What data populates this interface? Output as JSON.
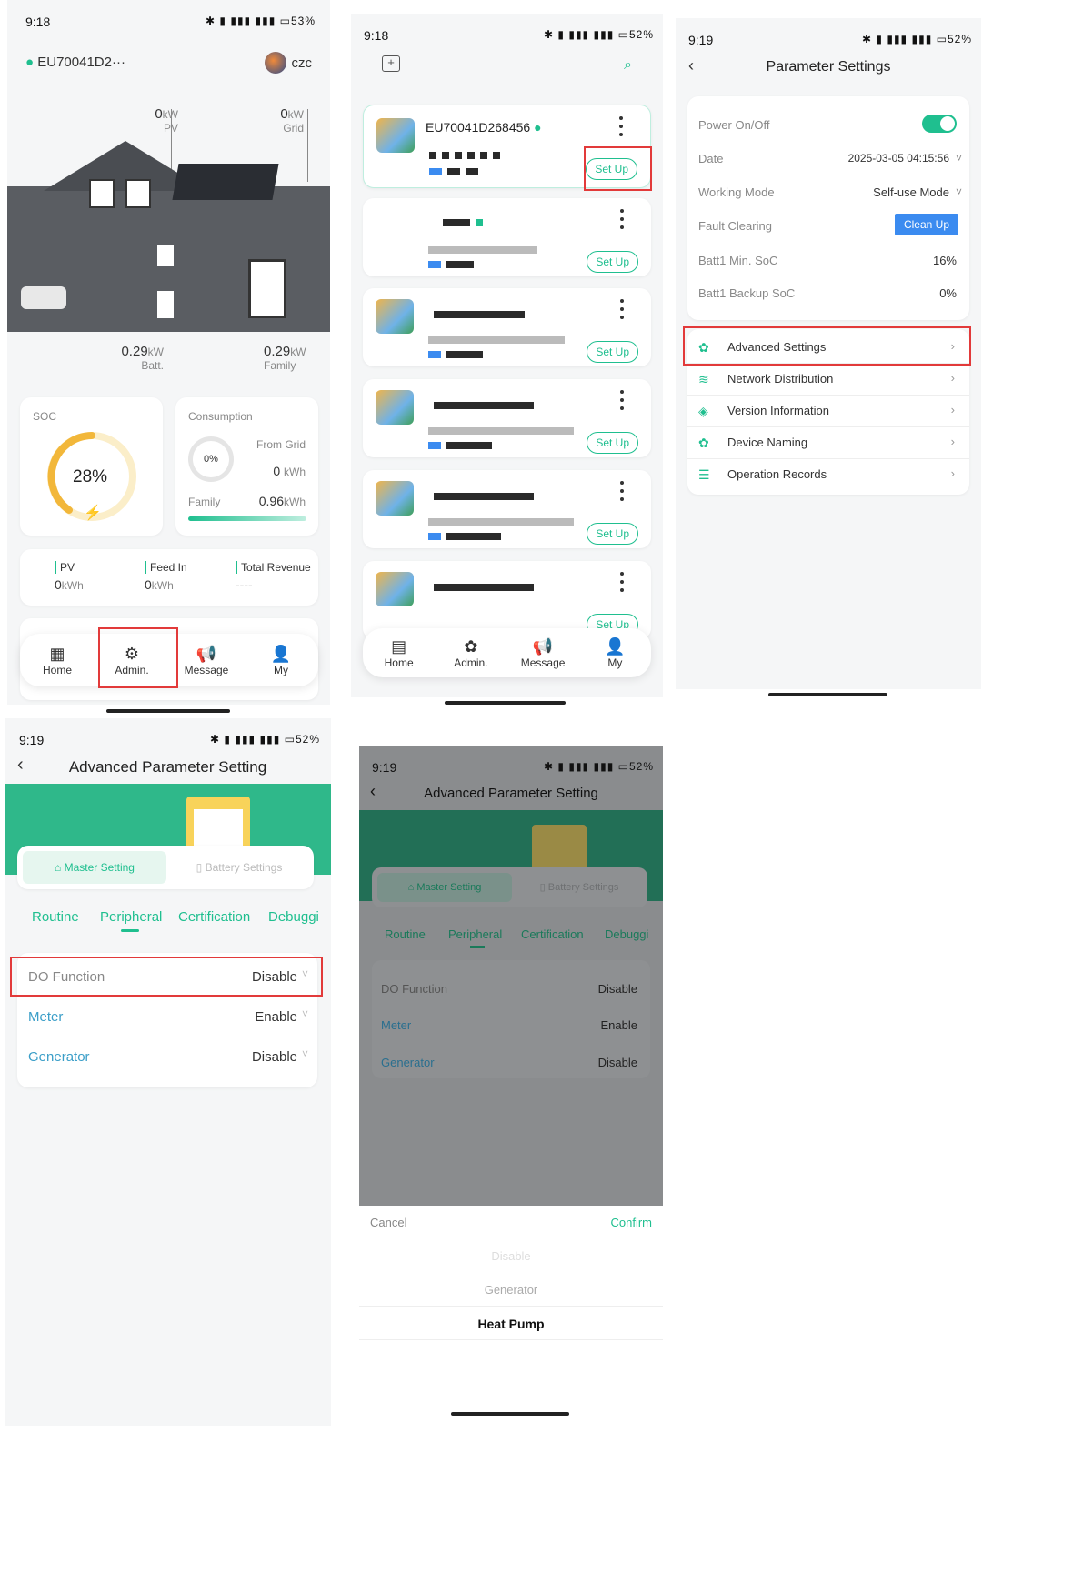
{
  "panel1": {
    "status": {
      "time": "9:18",
      "battery": "53"
    },
    "device": "EU70041D2···",
    "user": "czc",
    "pv": {
      "value": "0",
      "unit": "kW",
      "label": "PV"
    },
    "grid": {
      "value": "0",
      "unit": "kW",
      "label": "Grid"
    },
    "batt": {
      "value": "0.29",
      "unit": "kW",
      "label": "Batt."
    },
    "family": {
      "value": "0.29",
      "unit": "kW",
      "label": "Family"
    },
    "soc": {
      "label": "SOC",
      "value": "28%",
      "fraction": 0.28
    },
    "consumption": {
      "label": "Consumption",
      "pct": "0%",
      "from_grid_label": "From Grid",
      "from_grid_value": "0",
      "from_grid_unit": "kWh",
      "family_label": "Family",
      "family_value": "0.96",
      "family_unit": "kWh"
    },
    "stats": [
      {
        "label": "PV",
        "value": "0",
        "unit": "kWh"
      },
      {
        "label": "Feed In",
        "value": "0",
        "unit": "kWh"
      },
      {
        "label": "Total Revenue",
        "value": "----",
        "unit": ""
      }
    ],
    "tabs": [
      {
        "label": "Home",
        "icon": "dashboard-icon"
      },
      {
        "label": "Admin.",
        "icon": "gear-icon"
      },
      {
        "label": "Message",
        "icon": "megaphone-icon"
      },
      {
        "label": "My",
        "icon": "user-icon"
      }
    ]
  },
  "panel2": {
    "status": {
      "time": "9:18",
      "battery": "52"
    },
    "first_device": "EU70041D268456",
    "setup_label": "Set Up",
    "tabs": [
      {
        "label": "Home",
        "icon": "device-list-icon"
      },
      {
        "label": "Admin.",
        "icon": "gear-icon"
      },
      {
        "label": "Message",
        "icon": "megaphone-icon"
      },
      {
        "label": "My",
        "icon": "user-icon"
      }
    ]
  },
  "panel3": {
    "status": {
      "time": "9:19",
      "battery": "52"
    },
    "title": "Parameter Settings",
    "rows": [
      {
        "key": "Power On/Off",
        "value": ""
      },
      {
        "key": "Date",
        "value": "2025-03-05 04:15:56"
      },
      {
        "key": "Working Mode",
        "value": "Self-use Mode"
      },
      {
        "key": "Fault Clearing",
        "value": "Clean Up"
      },
      {
        "key": "Batt1 Min. SoC",
        "value": "16%"
      },
      {
        "key": "Batt1 Backup SoC",
        "value": "0%"
      }
    ],
    "menu": [
      {
        "label": "Advanced Settings",
        "icon": "gear-icon"
      },
      {
        "label": "Network Distribution",
        "icon": "wifi-icon"
      },
      {
        "label": "Version Information",
        "icon": "layers-icon"
      },
      {
        "label": "Device Naming",
        "icon": "gear-icon"
      },
      {
        "label": "Operation Records",
        "icon": "sliders-icon"
      }
    ]
  },
  "panel4": {
    "status": {
      "time": "9:19",
      "battery": "52"
    },
    "title": "Advanced Parameter Setting",
    "master": "Master Setting",
    "battery": "Battery Settings",
    "subtabs": [
      "Routine",
      "Peripheral",
      "Certification",
      "Debuggi"
    ],
    "fields": [
      {
        "key": "DO Function",
        "value": "Disable"
      },
      {
        "key": "Meter",
        "value": "Enable"
      },
      {
        "key": "Generator",
        "value": "Disable"
      }
    ]
  },
  "panel5": {
    "status": {
      "time": "9:19",
      "battery": "52"
    },
    "title": "Advanced Parameter Setting",
    "master": "Master Setting",
    "battery": "Battery Settings",
    "subtabs": [
      "Routine",
      "Peripheral",
      "Certification",
      "Debuggi"
    ],
    "fields": [
      {
        "key": "DO Function",
        "value": "Disable"
      },
      {
        "key": "Meter",
        "value": "Enable"
      },
      {
        "key": "Generator",
        "value": "Disable"
      }
    ],
    "cancel": "Cancel",
    "confirm": "Confirm",
    "options": [
      "Disable",
      "Generator",
      "Heat Pump"
    ]
  }
}
